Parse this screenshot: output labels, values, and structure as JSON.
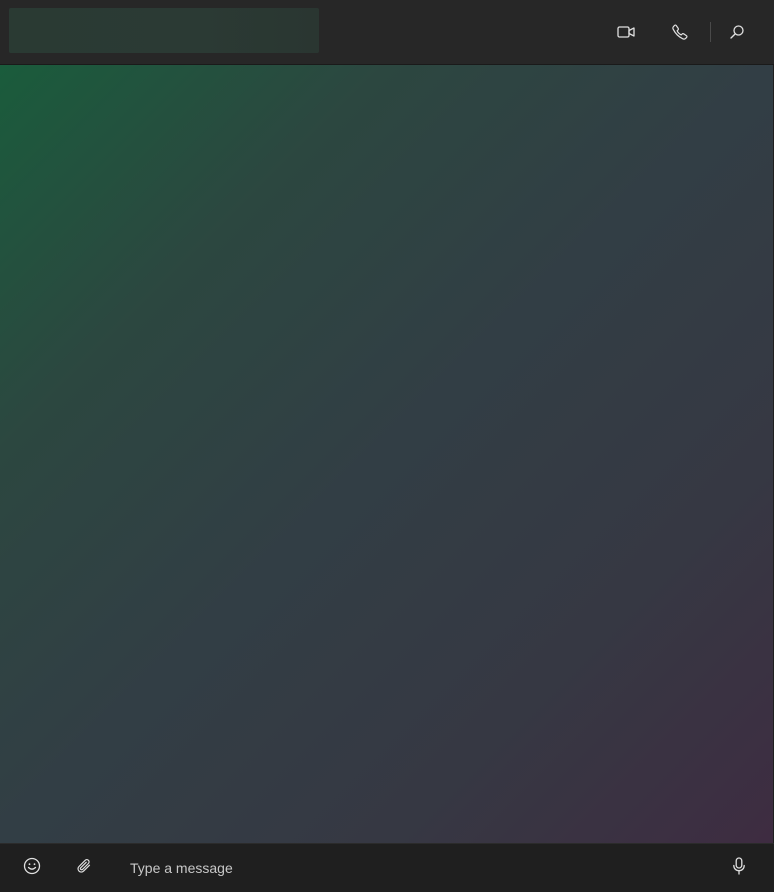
{
  "header": {
    "actions": [
      {
        "name": "video-call",
        "icon": "video-camera-icon"
      },
      {
        "name": "voice-call",
        "icon": "phone-icon"
      },
      {
        "name": "search",
        "icon": "search-icon"
      }
    ]
  },
  "chat": {
    "background_gradient": [
      "#1a5c3c",
      "#323e45",
      "#3e2c41"
    ]
  },
  "composer": {
    "placeholder": "Type a message",
    "value": "",
    "buttons": [
      {
        "name": "emoji",
        "icon": "smiley-icon"
      },
      {
        "name": "attach",
        "icon": "paperclip-icon"
      },
      {
        "name": "voice-message",
        "icon": "microphone-icon"
      }
    ]
  },
  "colors": {
    "header_bg": "#272727",
    "composer_bg": "#1f1f1f",
    "icon": "#e0e0e0"
  }
}
